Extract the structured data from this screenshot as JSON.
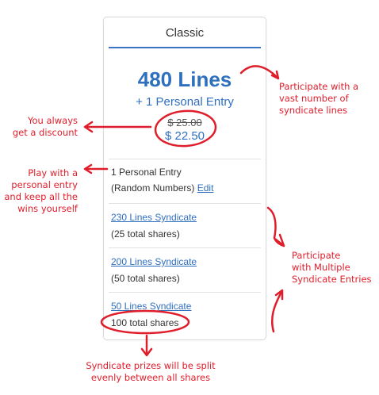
{
  "card": {
    "title": "Classic",
    "lines_headline": "480 Lines",
    "personal_entry_headline": "+ 1 Personal Entry",
    "old_price": "$ 25.00",
    "new_price": "$ 22.50",
    "personal": {
      "title": "1 Personal Entry",
      "detail": "(Random Numbers)",
      "edit_label": "Edit"
    },
    "syndicates": [
      {
        "label": "230 Lines Syndicate",
        "shares": "(25 total shares)"
      },
      {
        "label": "200 Lines Syndicate",
        "shares": "(50 total shares)"
      },
      {
        "label": "50 Lines Syndicate",
        "shares": "100 total shares"
      }
    ]
  },
  "annotations": {
    "lines_note": [
      "Participate with a",
      "vast number of",
      "syndicate lines"
    ],
    "discount_note": [
      "You always",
      "get a discount"
    ],
    "personal_note": [
      "Play with a",
      "personal entry",
      "and keep all the",
      "wins yourself"
    ],
    "syndicate_note": [
      "Participate",
      "with Multiple",
      "Syndicate Entries"
    ],
    "shares_note": [
      "Syndicate prizes will be split",
      "evenly between all shares"
    ]
  },
  "colors": {
    "accent_blue": "#2f6fbf",
    "annotation_red": "#e01e2b",
    "border": "#d9d9d9"
  }
}
